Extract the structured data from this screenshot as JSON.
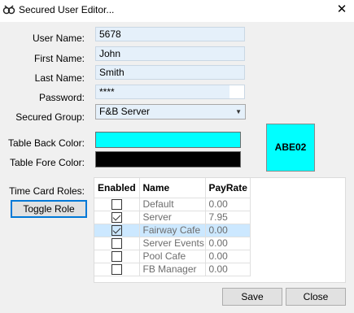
{
  "window": {
    "title": "Secured User Editor..."
  },
  "form": {
    "user_name_label": "User Name:",
    "user_name_value": "5678",
    "first_name_label": "First Name:",
    "first_name_value": "John",
    "last_name_label": "Last Name:",
    "last_name_value": "Smith",
    "password_label": "Password:",
    "password_value": "****",
    "secured_group_label": "Secured Group:",
    "secured_group_value": "F&B Server",
    "table_back_color_label": "Table Back Color:",
    "table_fore_color_label": "Table Fore Color:",
    "time_card_roles_label": "Time Card Roles:",
    "toggle_role_label": "Toggle Role"
  },
  "colors": {
    "table_back": "#00ffff",
    "table_fore": "#000000"
  },
  "preview": {
    "text": "ABE02"
  },
  "roles_table": {
    "headers": [
      "Enabled",
      "Name",
      "PayRate"
    ],
    "rows": [
      {
        "enabled": false,
        "name": "Default",
        "pay_rate": "0.00"
      },
      {
        "enabled": true,
        "name": "Server",
        "pay_rate": "7.95"
      },
      {
        "enabled": true,
        "name": "Fairway Cafe",
        "pay_rate": "0.00",
        "selected": true
      },
      {
        "enabled": false,
        "name": "Server Events",
        "pay_rate": "0.00"
      },
      {
        "enabled": false,
        "name": "Pool Cafe",
        "pay_rate": "0.00"
      },
      {
        "enabled": false,
        "name": "FB Manager",
        "pay_rate": "0.00"
      }
    ]
  },
  "buttons": {
    "save": "Save",
    "close": "Close"
  }
}
